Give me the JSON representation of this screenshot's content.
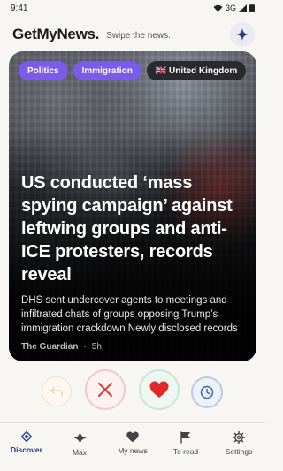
{
  "status_bar": {
    "time": "9:41",
    "network": "3G"
  },
  "header": {
    "logo": "GetMyNews.",
    "tagline": "Swipe the news."
  },
  "card": {
    "tags": [
      "Politics",
      "Immigration",
      "🇬🇧 United Kingdom"
    ],
    "headline": "US conducted ‘mass spying campaign’ against leftwing groups and anti-ICE protesters, records reveal",
    "summary": "DHS sent undercover agents to meetings and infiltrated chats of groups opposing Trump’s immigration crackdown Newly disclosed records …",
    "source": "The Guardian",
    "separator": "·",
    "age": "5h"
  },
  "actions": {
    "undo_icon": "undo-icon",
    "reject_icon": "close-icon",
    "like_icon": "heart-icon",
    "later_icon": "clock-icon"
  },
  "nav": {
    "items": [
      {
        "label": "Discover",
        "icon": "discover-icon",
        "active": true
      },
      {
        "label": "Max",
        "icon": "sparkle-icon",
        "active": false
      },
      {
        "label": "My news",
        "icon": "heart-icon",
        "active": false
      },
      {
        "label": "To read",
        "icon": "flag-icon",
        "active": false
      },
      {
        "label": "Settings",
        "icon": "gear-icon",
        "active": false
      }
    ]
  },
  "colors": {
    "accent_purple": "#7b5bea",
    "nav_active": "#1e3a8a",
    "reject_red": "#e0403a",
    "like_red": "#e02a2a",
    "later_blue": "#3b64b0"
  }
}
